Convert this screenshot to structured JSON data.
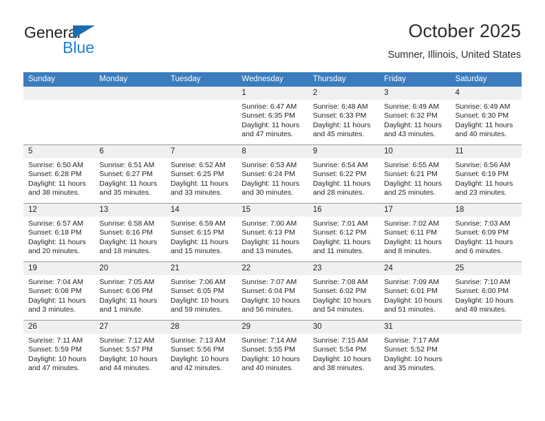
{
  "brand": {
    "name_top": "General",
    "name_bottom": "Blue",
    "triangle_color": "#1b6cb5",
    "text_color": "#1b7fd4"
  },
  "header": {
    "title": "October 2025",
    "subtitle": "Sumner, Illinois, United States"
  },
  "theme": {
    "header_row_bg": "#3a7cbe",
    "header_row_text": "#ffffff",
    "daynum_bg": "#f0f0f0",
    "cell_border": "#9a9a9a",
    "text": "#231f20"
  },
  "weekday_headers": [
    "Sunday",
    "Monday",
    "Tuesday",
    "Wednesday",
    "Thursday",
    "Friday",
    "Saturday"
  ],
  "weeks": [
    [
      {
        "day": "",
        "sunrise": "",
        "sunset": "",
        "daylight_line1": "",
        "daylight_line2": ""
      },
      {
        "day": "",
        "sunrise": "",
        "sunset": "",
        "daylight_line1": "",
        "daylight_line2": ""
      },
      {
        "day": "",
        "sunrise": "",
        "sunset": "",
        "daylight_line1": "",
        "daylight_line2": ""
      },
      {
        "day": "1",
        "sunrise": "Sunrise: 6:47 AM",
        "sunset": "Sunset: 6:35 PM",
        "daylight_line1": "Daylight: 11 hours",
        "daylight_line2": "and 47 minutes."
      },
      {
        "day": "2",
        "sunrise": "Sunrise: 6:48 AM",
        "sunset": "Sunset: 6:33 PM",
        "daylight_line1": "Daylight: 11 hours",
        "daylight_line2": "and 45 minutes."
      },
      {
        "day": "3",
        "sunrise": "Sunrise: 6:49 AM",
        "sunset": "Sunset: 6:32 PM",
        "daylight_line1": "Daylight: 11 hours",
        "daylight_line2": "and 43 minutes."
      },
      {
        "day": "4",
        "sunrise": "Sunrise: 6:49 AM",
        "sunset": "Sunset: 6:30 PM",
        "daylight_line1": "Daylight: 11 hours",
        "daylight_line2": "and 40 minutes."
      }
    ],
    [
      {
        "day": "5",
        "sunrise": "Sunrise: 6:50 AM",
        "sunset": "Sunset: 6:28 PM",
        "daylight_line1": "Daylight: 11 hours",
        "daylight_line2": "and 38 minutes."
      },
      {
        "day": "6",
        "sunrise": "Sunrise: 6:51 AM",
        "sunset": "Sunset: 6:27 PM",
        "daylight_line1": "Daylight: 11 hours",
        "daylight_line2": "and 35 minutes."
      },
      {
        "day": "7",
        "sunrise": "Sunrise: 6:52 AM",
        "sunset": "Sunset: 6:25 PM",
        "daylight_line1": "Daylight: 11 hours",
        "daylight_line2": "and 33 minutes."
      },
      {
        "day": "8",
        "sunrise": "Sunrise: 6:53 AM",
        "sunset": "Sunset: 6:24 PM",
        "daylight_line1": "Daylight: 11 hours",
        "daylight_line2": "and 30 minutes."
      },
      {
        "day": "9",
        "sunrise": "Sunrise: 6:54 AM",
        "sunset": "Sunset: 6:22 PM",
        "daylight_line1": "Daylight: 11 hours",
        "daylight_line2": "and 28 minutes."
      },
      {
        "day": "10",
        "sunrise": "Sunrise: 6:55 AM",
        "sunset": "Sunset: 6:21 PM",
        "daylight_line1": "Daylight: 11 hours",
        "daylight_line2": "and 25 minutes."
      },
      {
        "day": "11",
        "sunrise": "Sunrise: 6:56 AM",
        "sunset": "Sunset: 6:19 PM",
        "daylight_line1": "Daylight: 11 hours",
        "daylight_line2": "and 23 minutes."
      }
    ],
    [
      {
        "day": "12",
        "sunrise": "Sunrise: 6:57 AM",
        "sunset": "Sunset: 6:18 PM",
        "daylight_line1": "Daylight: 11 hours",
        "daylight_line2": "and 20 minutes."
      },
      {
        "day": "13",
        "sunrise": "Sunrise: 6:58 AM",
        "sunset": "Sunset: 6:16 PM",
        "daylight_line1": "Daylight: 11 hours",
        "daylight_line2": "and 18 minutes."
      },
      {
        "day": "14",
        "sunrise": "Sunrise: 6:59 AM",
        "sunset": "Sunset: 6:15 PM",
        "daylight_line1": "Daylight: 11 hours",
        "daylight_line2": "and 15 minutes."
      },
      {
        "day": "15",
        "sunrise": "Sunrise: 7:00 AM",
        "sunset": "Sunset: 6:13 PM",
        "daylight_line1": "Daylight: 11 hours",
        "daylight_line2": "and 13 minutes."
      },
      {
        "day": "16",
        "sunrise": "Sunrise: 7:01 AM",
        "sunset": "Sunset: 6:12 PM",
        "daylight_line1": "Daylight: 11 hours",
        "daylight_line2": "and 11 minutes."
      },
      {
        "day": "17",
        "sunrise": "Sunrise: 7:02 AM",
        "sunset": "Sunset: 6:11 PM",
        "daylight_line1": "Daylight: 11 hours",
        "daylight_line2": "and 8 minutes."
      },
      {
        "day": "18",
        "sunrise": "Sunrise: 7:03 AM",
        "sunset": "Sunset: 6:09 PM",
        "daylight_line1": "Daylight: 11 hours",
        "daylight_line2": "and 6 minutes."
      }
    ],
    [
      {
        "day": "19",
        "sunrise": "Sunrise: 7:04 AM",
        "sunset": "Sunset: 6:08 PM",
        "daylight_line1": "Daylight: 11 hours",
        "daylight_line2": "and 3 minutes."
      },
      {
        "day": "20",
        "sunrise": "Sunrise: 7:05 AM",
        "sunset": "Sunset: 6:06 PM",
        "daylight_line1": "Daylight: 11 hours",
        "daylight_line2": "and 1 minute."
      },
      {
        "day": "21",
        "sunrise": "Sunrise: 7:06 AM",
        "sunset": "Sunset: 6:05 PM",
        "daylight_line1": "Daylight: 10 hours",
        "daylight_line2": "and 59 minutes."
      },
      {
        "day": "22",
        "sunrise": "Sunrise: 7:07 AM",
        "sunset": "Sunset: 6:04 PM",
        "daylight_line1": "Daylight: 10 hours",
        "daylight_line2": "and 56 minutes."
      },
      {
        "day": "23",
        "sunrise": "Sunrise: 7:08 AM",
        "sunset": "Sunset: 6:02 PM",
        "daylight_line1": "Daylight: 10 hours",
        "daylight_line2": "and 54 minutes."
      },
      {
        "day": "24",
        "sunrise": "Sunrise: 7:09 AM",
        "sunset": "Sunset: 6:01 PM",
        "daylight_line1": "Daylight: 10 hours",
        "daylight_line2": "and 51 minutes."
      },
      {
        "day": "25",
        "sunrise": "Sunrise: 7:10 AM",
        "sunset": "Sunset: 6:00 PM",
        "daylight_line1": "Daylight: 10 hours",
        "daylight_line2": "and 49 minutes."
      }
    ],
    [
      {
        "day": "26",
        "sunrise": "Sunrise: 7:11 AM",
        "sunset": "Sunset: 5:59 PM",
        "daylight_line1": "Daylight: 10 hours",
        "daylight_line2": "and 47 minutes."
      },
      {
        "day": "27",
        "sunrise": "Sunrise: 7:12 AM",
        "sunset": "Sunset: 5:57 PM",
        "daylight_line1": "Daylight: 10 hours",
        "daylight_line2": "and 44 minutes."
      },
      {
        "day": "28",
        "sunrise": "Sunrise: 7:13 AM",
        "sunset": "Sunset: 5:56 PM",
        "daylight_line1": "Daylight: 10 hours",
        "daylight_line2": "and 42 minutes."
      },
      {
        "day": "29",
        "sunrise": "Sunrise: 7:14 AM",
        "sunset": "Sunset: 5:55 PM",
        "daylight_line1": "Daylight: 10 hours",
        "daylight_line2": "and 40 minutes."
      },
      {
        "day": "30",
        "sunrise": "Sunrise: 7:15 AM",
        "sunset": "Sunset: 5:54 PM",
        "daylight_line1": "Daylight: 10 hours",
        "daylight_line2": "and 38 minutes."
      },
      {
        "day": "31",
        "sunrise": "Sunrise: 7:17 AM",
        "sunset": "Sunset: 5:52 PM",
        "daylight_line1": "Daylight: 10 hours",
        "daylight_line2": "and 35 minutes."
      },
      {
        "day": "",
        "sunrise": "",
        "sunset": "",
        "daylight_line1": "",
        "daylight_line2": ""
      }
    ]
  ]
}
